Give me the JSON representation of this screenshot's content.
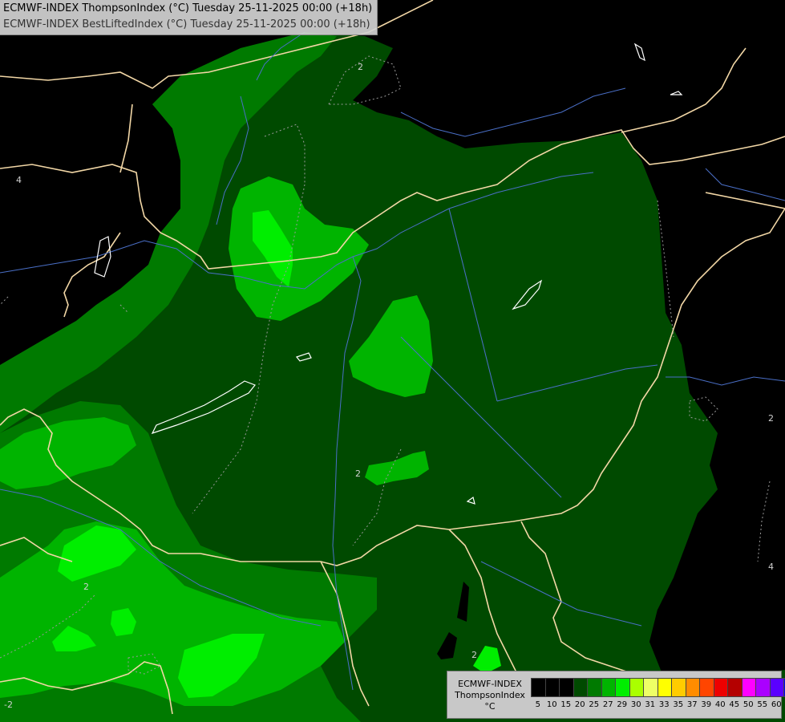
{
  "header": {
    "title_line1": "ECMWF-INDEX ThompsonIndex (°C) Tuesday 25-11-2025 00:00 (+18h)",
    "title_line2": "ECMWF-INDEX BestLiftedIndex (°C) Tuesday 25-11-2025 00:00 (+18h)"
  },
  "legend": {
    "model": "ECMWF-INDEX",
    "parameter": "ThompsonIndex",
    "unit": "°C",
    "bins": [
      {
        "label": "5",
        "color": "#000000"
      },
      {
        "label": "10",
        "color": "#000000"
      },
      {
        "label": "15",
        "color": "#000000"
      },
      {
        "label": "20",
        "color": "#004a00"
      },
      {
        "label": "25",
        "color": "#007a00"
      },
      {
        "label": "27",
        "color": "#00b400"
      },
      {
        "label": "29",
        "color": "#00ee00"
      },
      {
        "label": "30",
        "color": "#aaff00"
      },
      {
        "label": "31",
        "color": "#eeff66"
      },
      {
        "label": "33",
        "color": "#ffff00"
      },
      {
        "label": "35",
        "color": "#ffcc00"
      },
      {
        "label": "37",
        "color": "#ff8c00"
      },
      {
        "label": "39",
        "color": "#ff4500"
      },
      {
        "label": "40",
        "color": "#ee0000"
      },
      {
        "label": "45",
        "color": "#b40000"
      },
      {
        "label": "50",
        "color": "#ff00ff"
      },
      {
        "label": "55",
        "color": "#aa00ff"
      },
      {
        "label": "60",
        "color": "#5a00ff"
      },
      {
        "label": "",
        "color": "#0000ff"
      }
    ]
  },
  "map": {
    "colors": {
      "background": "#000000",
      "level_20": "#004a00",
      "level_25": "#007a00",
      "level_27": "#00b400",
      "level_29": "#00ee00",
      "border": "#f2d7a6",
      "river": "#4a6fc7",
      "lake": "#ffffff"
    },
    "contour_labels": [
      "2",
      "2",
      "2",
      "2",
      "2",
      "2",
      "4",
      "4",
      "-2"
    ]
  }
}
